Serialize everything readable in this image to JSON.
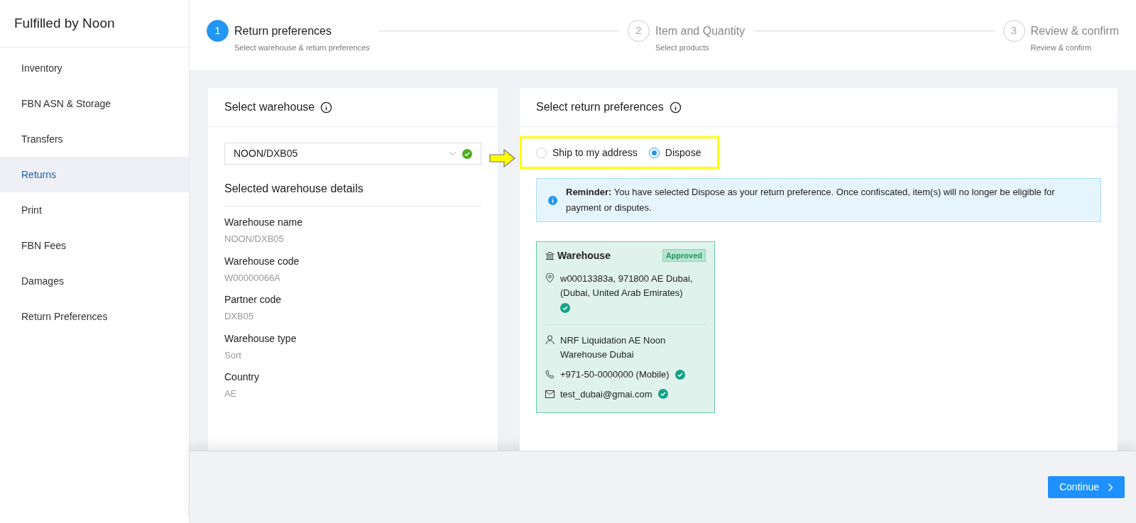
{
  "sidebar": {
    "title": "Fulfilled by Noon",
    "items": [
      {
        "label": "Inventory",
        "selected": false
      },
      {
        "label": "FBN ASN & Storage",
        "selected": false
      },
      {
        "label": "Transfers",
        "selected": false
      },
      {
        "label": "Returns",
        "selected": true
      },
      {
        "label": "Print",
        "selected": false
      },
      {
        "label": "FBN Fees",
        "selected": false
      },
      {
        "label": "Damages",
        "selected": false
      },
      {
        "label": "Return Preferences",
        "selected": false
      }
    ]
  },
  "steps": [
    {
      "number": "1",
      "title": "Return preferences",
      "subtitle": "Select warehouse & return preferences",
      "selected": true
    },
    {
      "number": "2",
      "title": "Item and Quantity",
      "subtitle": "Select products",
      "selected": false
    },
    {
      "number": "3",
      "title": "Review & confirm",
      "subtitle": "Review & confirm",
      "selected": false
    }
  ],
  "warehouse_panel": {
    "title": "Select warehouse",
    "select_value": "NOON/DXB05",
    "details_title": "Selected warehouse details",
    "details": [
      {
        "label": "Warehouse name",
        "value": "NOON/DXB05"
      },
      {
        "label": "Warehouse code",
        "value": "W00000066A"
      },
      {
        "label": "Partner code",
        "value": "DXB05"
      },
      {
        "label": "Warehouse type",
        "value": "Sort"
      },
      {
        "label": "Country",
        "value": "AE"
      }
    ]
  },
  "preferences_panel": {
    "title": "Select return preferences",
    "options": [
      {
        "label": "Ship to my address",
        "selected": false
      },
      {
        "label": "Dispose",
        "selected": true
      }
    ],
    "reminder": "**Reminder:** You have selected Dispose as your return preference. Once confiscated, item(s) will no longer be eligible for payment or disputes.",
    "card": {
      "title": "Warehouse",
      "badge": "Approved",
      "address": "w00013383a, 971800 AE Dubai, (Dubai, United Arab Emirates)",
      "contact": "NRF Liquidation AE Noon Warehouse Dubai",
      "phone": "+971-50-0000000 (Mobile)",
      "email": "test_dubai@gmai.com"
    }
  },
  "continue_button": "Continue"
}
